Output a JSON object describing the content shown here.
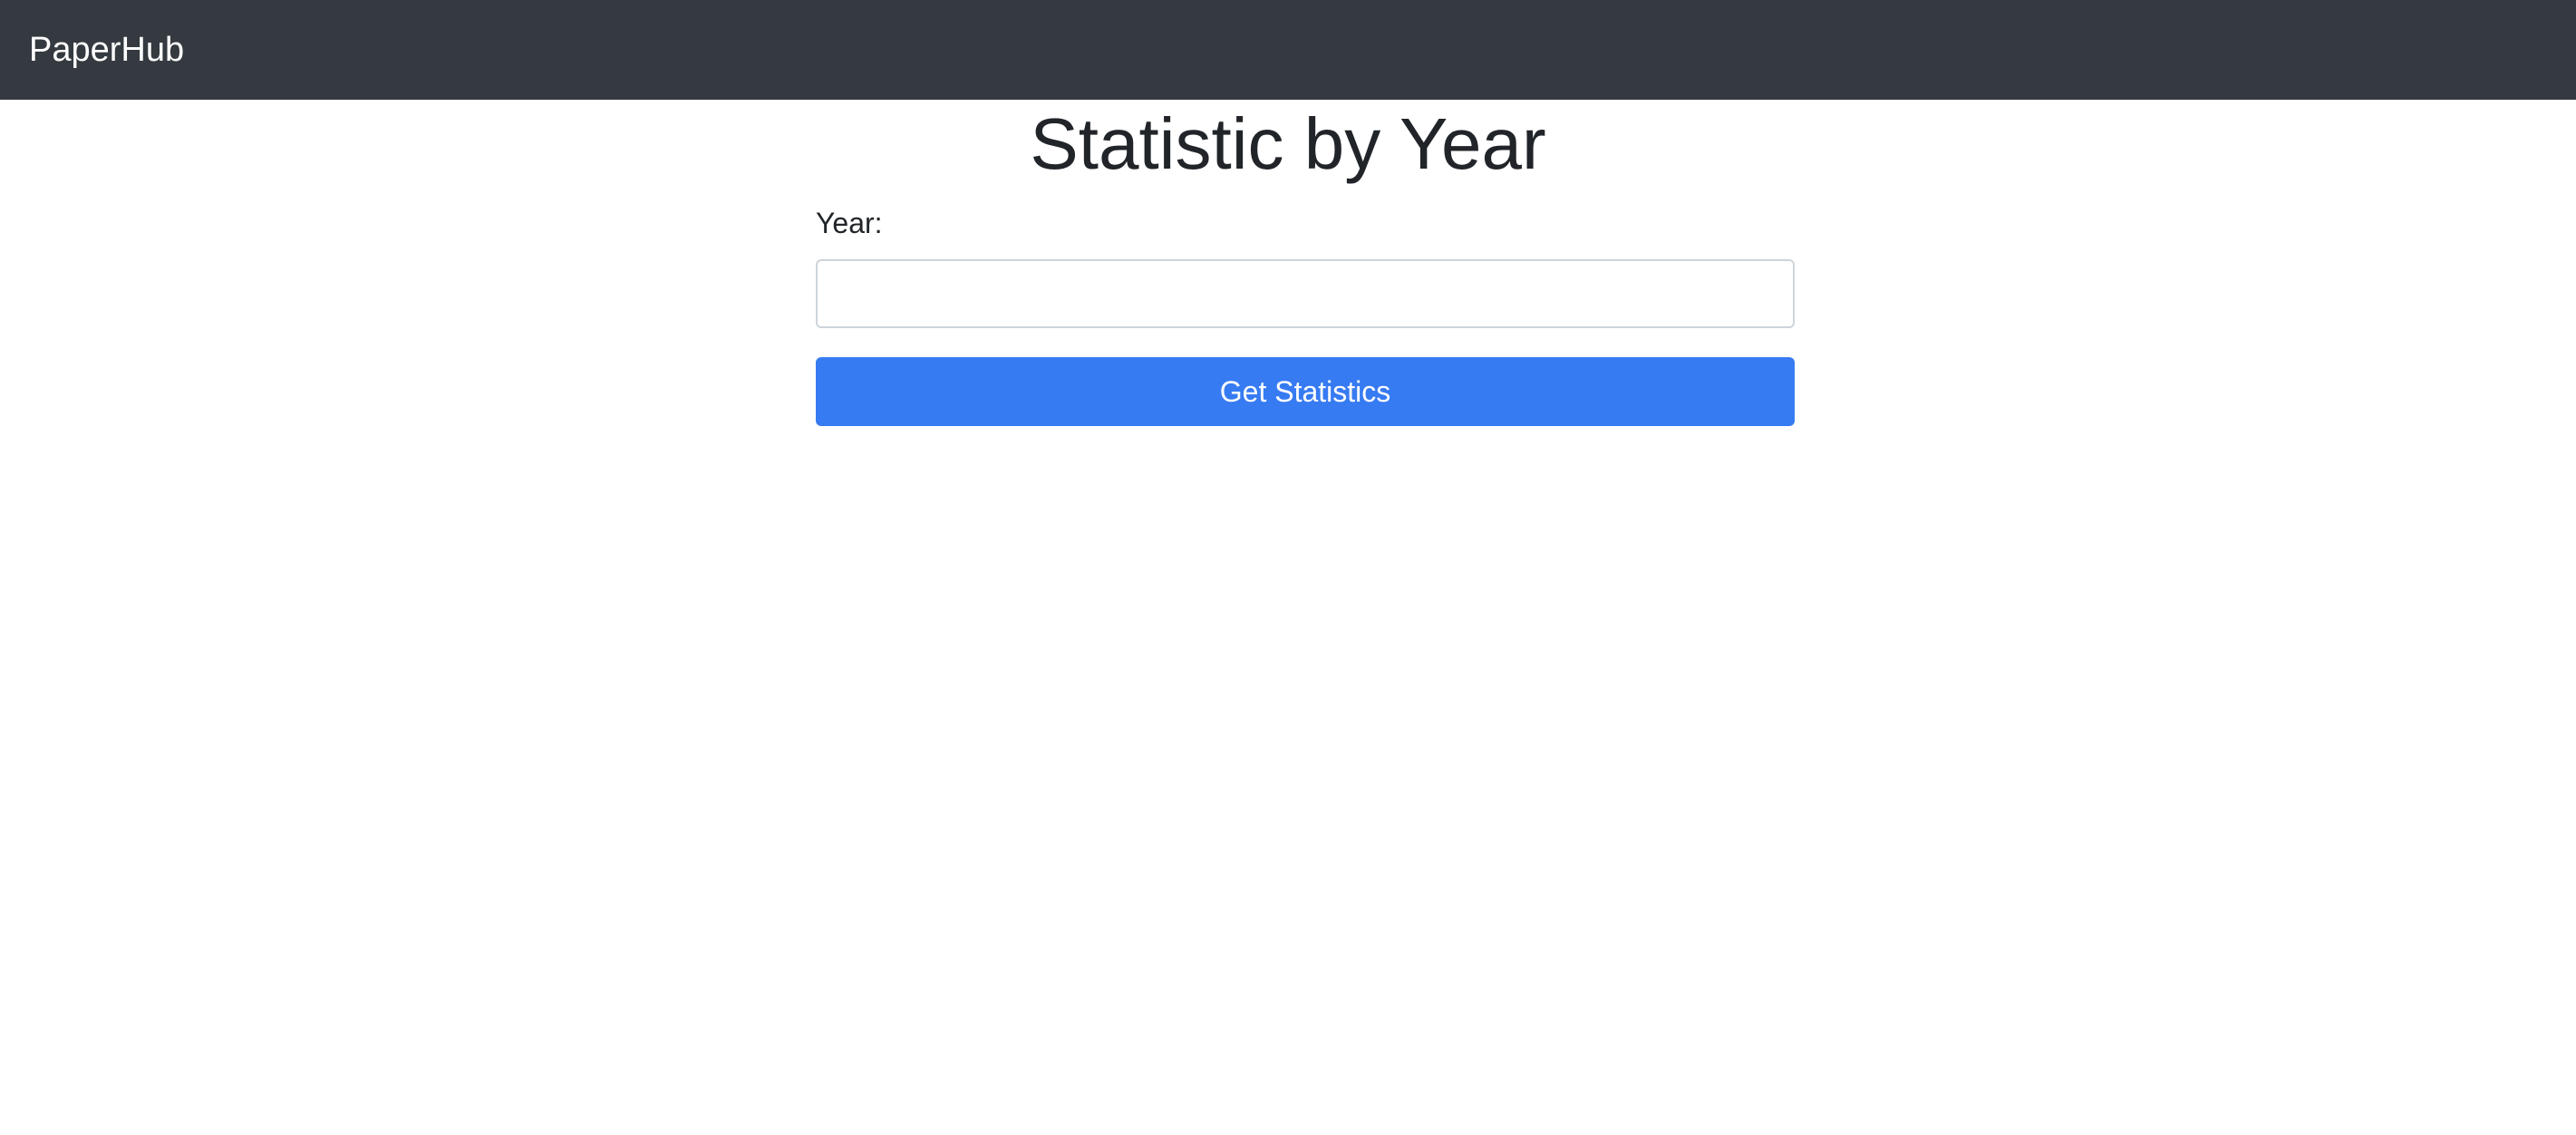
{
  "navbar": {
    "brand": "PaperHub"
  },
  "main": {
    "title": "Statistic by Year",
    "form": {
      "year_label": "Year:",
      "year_value": "",
      "year_placeholder": "",
      "submit_label": "Get Statistics"
    }
  },
  "colors": {
    "navbar_bg": "#343a40",
    "primary_button": "#377bf2",
    "heading_text": "#212529"
  }
}
